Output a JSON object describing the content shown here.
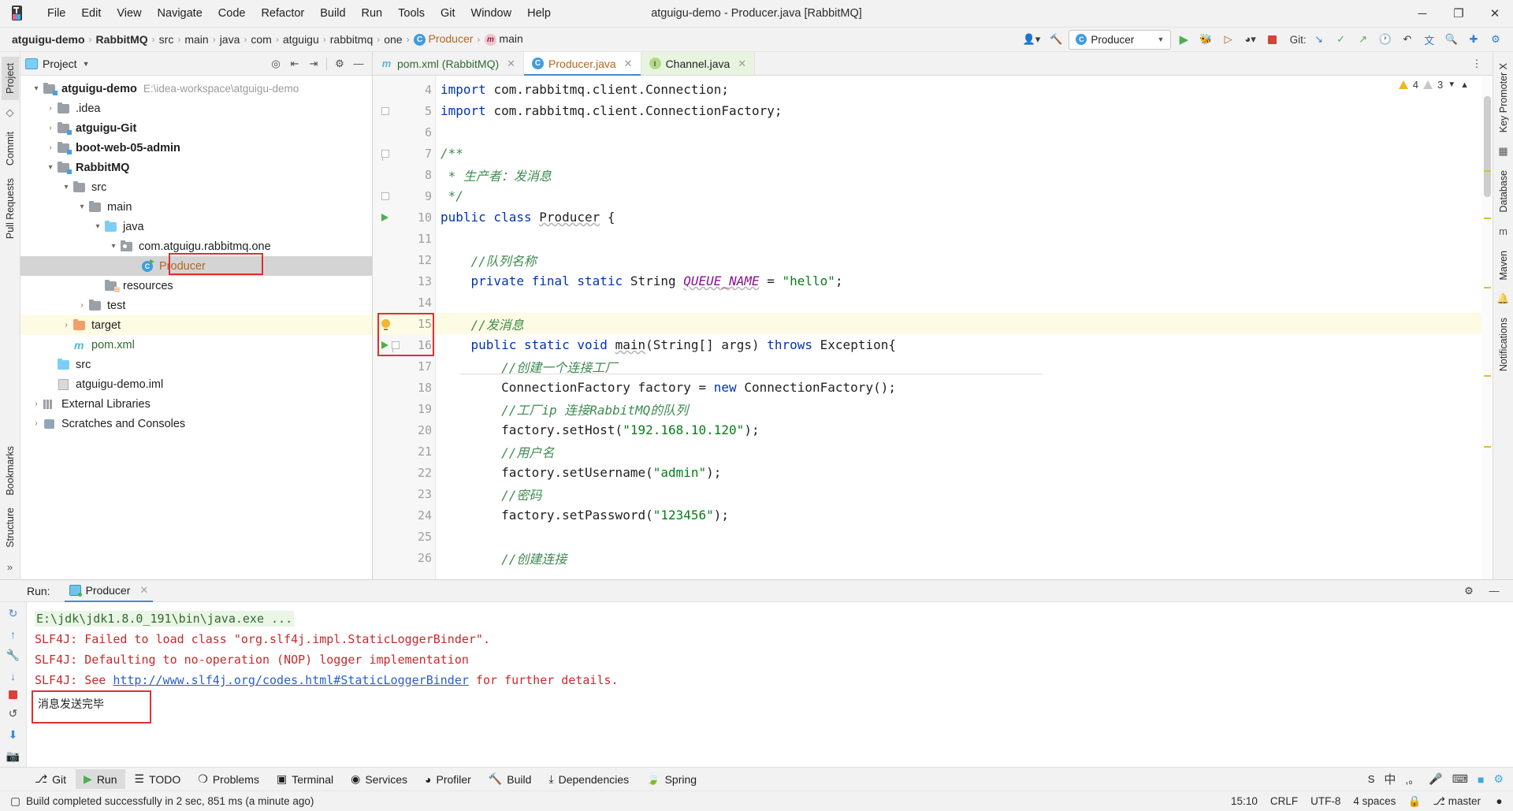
{
  "window": {
    "title": "atguigu-demo - Producer.java [RabbitMQ]",
    "minimize": "─",
    "maximize": "❐",
    "close": "✕"
  },
  "menubar": [
    {
      "label": "File"
    },
    {
      "label": "Edit"
    },
    {
      "label": "View"
    },
    {
      "label": "Navigate"
    },
    {
      "label": "Code"
    },
    {
      "label": "Refactor"
    },
    {
      "label": "Build"
    },
    {
      "label": "Run"
    },
    {
      "label": "Tools"
    },
    {
      "label": "Git"
    },
    {
      "label": "Window"
    },
    {
      "label": "Help"
    }
  ],
  "breadcrumb": [
    {
      "label": "atguigu-demo",
      "style": "bold"
    },
    {
      "label": "RabbitMQ",
      "style": "bold"
    },
    {
      "label": "src",
      "style": "normal"
    },
    {
      "label": "main",
      "style": "normal"
    },
    {
      "label": "java",
      "style": "normal"
    },
    {
      "label": "com",
      "style": "normal"
    },
    {
      "label": "atguigu",
      "style": "normal"
    },
    {
      "label": "rabbitmq",
      "style": "normal"
    },
    {
      "label": "one",
      "style": "normal"
    },
    {
      "label": "Producer",
      "style": "class"
    },
    {
      "label": "main",
      "style": "method"
    }
  ],
  "toolbar": {
    "run_config": "Producer",
    "git_label": "Git:",
    "separator": "›"
  },
  "project_panel": {
    "title": "Project",
    "tree": [
      {
        "indent": 0,
        "arrow": "v",
        "icon": "folder-module",
        "label": "atguigu-demo",
        "bold": true,
        "path": "E:\\idea-workspace\\atguigu-demo"
      },
      {
        "indent": 1,
        "arrow": ">",
        "icon": "folder-gray",
        "label": ".idea",
        "bold": false
      },
      {
        "indent": 1,
        "arrow": ">",
        "icon": "folder-module",
        "label": "atguigu-Git",
        "bold": true
      },
      {
        "indent": 1,
        "arrow": ">",
        "icon": "folder-module",
        "label": "boot-web-05-admin",
        "bold": true
      },
      {
        "indent": 1,
        "arrow": "v",
        "icon": "folder-module",
        "label": "RabbitMQ",
        "bold": true
      },
      {
        "indent": 2,
        "arrow": "v",
        "icon": "folder-gray",
        "label": "src",
        "bold": false
      },
      {
        "indent": 3,
        "arrow": "v",
        "icon": "folder-gray",
        "label": "main",
        "bold": false
      },
      {
        "indent": 4,
        "arrow": "v",
        "icon": "folder-blue",
        "label": "java",
        "bold": false
      },
      {
        "indent": 5,
        "arrow": "v",
        "icon": "package",
        "label": "com.atguigu.rabbitmq.one",
        "bold": false
      },
      {
        "indent": 6,
        "arrow": "",
        "icon": "java-class",
        "label": "Producer",
        "bold": false,
        "color": "orange",
        "selected": true,
        "boxed": true
      },
      {
        "indent": 5,
        "arrow": "",
        "icon": "folder-res",
        "label": "resources",
        "bold": false
      },
      {
        "indent": 3,
        "arrow": ">",
        "icon": "folder-gray",
        "label": "test",
        "bold": false
      },
      {
        "indent": 2,
        "arrow": ">",
        "icon": "folder-orange",
        "label": "target",
        "bold": false,
        "highlight": true
      },
      {
        "indent": 2,
        "arrow": "",
        "icon": "maven",
        "label": "pom.xml",
        "bold": false,
        "color": "green"
      },
      {
        "indent": 1,
        "arrow": "",
        "icon": "folder-blue",
        "label": "src",
        "bold": false
      },
      {
        "indent": 1,
        "arrow": "",
        "icon": "iml",
        "label": "atguigu-demo.iml",
        "bold": false
      },
      {
        "indent": 0,
        "arrow": ">",
        "icon": "library",
        "label": "External Libraries",
        "bold": false
      },
      {
        "indent": 0,
        "arrow": ">",
        "icon": "scratch",
        "label": "Scratches and Consoles",
        "bold": false
      }
    ]
  },
  "left_strip": [
    "Project",
    "Commit",
    "Pull Requests"
  ],
  "right_strip": [
    "Key Promoter X",
    "Database",
    "Maven",
    "Notifications"
  ],
  "editor": {
    "tabs": [
      {
        "label": "pom.xml (RabbitMQ)",
        "icon": "maven-icon",
        "active": false,
        "kind": "xml"
      },
      {
        "label": "Producer.java",
        "icon": "java-class-icon",
        "active": true,
        "kind": "java"
      },
      {
        "label": "Channel.java",
        "icon": "java-interface-icon",
        "active": false,
        "kind": "java"
      }
    ],
    "inspections": {
      "warnings": "4",
      "weak_warnings": "3"
    },
    "lines": [
      {
        "num": "4",
        "marks": [],
        "tokens": [
          {
            "t": "import ",
            "c": "kw"
          },
          {
            "t": "com.rabbitmq.client.Connection;",
            "c": "plain"
          }
        ]
      },
      {
        "num": "5",
        "marks": [
          "fold"
        ],
        "tokens": [
          {
            "t": "import ",
            "c": "kw"
          },
          {
            "t": "com.rabbitmq.client.ConnectionFactory;",
            "c": "plain"
          }
        ]
      },
      {
        "num": "6",
        "marks": [],
        "tokens": []
      },
      {
        "num": "7",
        "marks": [
          "fold-open"
        ],
        "tokens": [
          {
            "t": "/**",
            "c": "cmt"
          }
        ]
      },
      {
        "num": "8",
        "marks": [],
        "tokens": [
          {
            "t": " * 生产者：发消息",
            "c": "cmt"
          }
        ]
      },
      {
        "num": "9",
        "marks": [
          "fold-end"
        ],
        "tokens": [
          {
            "t": " */",
            "c": "cmt"
          }
        ]
      },
      {
        "num": "10",
        "marks": [
          "run"
        ],
        "tokens": [
          {
            "t": "public class ",
            "c": "kw"
          },
          {
            "t": "Producer",
            "c": "cls2"
          },
          {
            "t": " {",
            "c": "plain"
          }
        ]
      },
      {
        "num": "11",
        "marks": [],
        "tokens": []
      },
      {
        "num": "12",
        "marks": [],
        "tokens": [
          {
            "t": "    //队列名称",
            "c": "cmt"
          }
        ]
      },
      {
        "num": "13",
        "marks": [],
        "tokens": [
          {
            "t": "    ",
            "c": "plain"
          },
          {
            "t": "private final static ",
            "c": "kw"
          },
          {
            "t": "String ",
            "c": "plain"
          },
          {
            "t": "QUEUE_NAME",
            "c": "field"
          },
          {
            "t": " = ",
            "c": "plain"
          },
          {
            "t": "\"hello\"",
            "c": "str"
          },
          {
            "t": ";",
            "c": "plain"
          }
        ]
      },
      {
        "num": "14",
        "marks": [],
        "tokens": []
      },
      {
        "num": "15",
        "marks": [
          "bulb"
        ],
        "highlight": true,
        "tokens": [
          {
            "t": "    //发消息",
            "c": "cmt"
          }
        ]
      },
      {
        "num": "16",
        "marks": [
          "run",
          "fold-open"
        ],
        "tokens": [
          {
            "t": "    ",
            "c": "plain"
          },
          {
            "t": "public static void ",
            "c": "kw"
          },
          {
            "t": "main",
            "c": "cls2"
          },
          {
            "t": "(String[] args) ",
            "c": "plain"
          },
          {
            "t": "throws ",
            "c": "kw"
          },
          {
            "t": "Exception{",
            "c": "plain"
          }
        ]
      },
      {
        "num": "17",
        "marks": [],
        "tokens": [
          {
            "t": "        //创建一个连接工厂",
            "c": "cmt"
          }
        ]
      },
      {
        "num": "18",
        "marks": [],
        "tokens": [
          {
            "t": "        ConnectionFactory factory = ",
            "c": "plain"
          },
          {
            "t": "new ",
            "c": "kw"
          },
          {
            "t": "ConnectionFactory();",
            "c": "plain"
          }
        ]
      },
      {
        "num": "19",
        "marks": [],
        "tokens": [
          {
            "t": "        //工厂ip 连接RabbitMQ的队列",
            "c": "cmt"
          }
        ]
      },
      {
        "num": "20",
        "marks": [],
        "tokens": [
          {
            "t": "        factory.setHost(",
            "c": "plain"
          },
          {
            "t": "\"192.168.10.120\"",
            "c": "str"
          },
          {
            "t": ");",
            "c": "plain"
          }
        ]
      },
      {
        "num": "21",
        "marks": [],
        "tokens": [
          {
            "t": "        //用户名",
            "c": "cmt"
          }
        ]
      },
      {
        "num": "22",
        "marks": [],
        "tokens": [
          {
            "t": "        factory.setUsername(",
            "c": "plain"
          },
          {
            "t": "\"admin\"",
            "c": "str"
          },
          {
            "t": ");",
            "c": "plain"
          }
        ]
      },
      {
        "num": "23",
        "marks": [],
        "tokens": [
          {
            "t": "        //密码",
            "c": "cmt"
          }
        ]
      },
      {
        "num": "24",
        "marks": [],
        "tokens": [
          {
            "t": "        factory.setPassword(",
            "c": "plain"
          },
          {
            "t": "\"123456\"",
            "c": "str"
          },
          {
            "t": ");",
            "c": "plain"
          }
        ]
      },
      {
        "num": "25",
        "marks": [],
        "tokens": []
      },
      {
        "num": "26",
        "marks": [],
        "tokens": [
          {
            "t": "        //创建连接",
            "c": "cmt"
          }
        ]
      }
    ]
  },
  "run_panel": {
    "label": "Run:",
    "tab_label": "Producer",
    "console": [
      {
        "segments": [
          {
            "text": "E:\\jdk\\jdk1.8.0_191\\bin\\java.exe ...",
            "style": "green-bg"
          }
        ]
      },
      {
        "segments": [
          {
            "text": "SLF4J: Failed to load class \"org.slf4j.impl.StaticLoggerBinder\".",
            "style": "red"
          }
        ]
      },
      {
        "segments": [
          {
            "text": "SLF4J: Defaulting to no-operation (NOP) logger implementation",
            "style": "red"
          }
        ]
      },
      {
        "segments": [
          {
            "text": "SLF4J: See ",
            "style": "red"
          },
          {
            "text": "http://www.slf4j.org/codes.html#StaticLoggerBinder",
            "style": "link"
          },
          {
            "text": " for further details.",
            "style": "red"
          }
        ]
      },
      {
        "segments": [
          {
            "text": "消息发送完毕",
            "style": "black"
          }
        ],
        "boxed": true
      }
    ]
  },
  "bottom_tabs": [
    {
      "label": "Git",
      "icon": "git-branch-icon",
      "active": false
    },
    {
      "label": "Run",
      "icon": "run-icon",
      "active": true
    },
    {
      "label": "TODO",
      "icon": "todo-icon",
      "active": false
    },
    {
      "label": "Problems",
      "icon": "problems-icon",
      "active": false
    },
    {
      "label": "Terminal",
      "icon": "terminal-icon",
      "active": false
    },
    {
      "label": "Services",
      "icon": "services-icon",
      "active": false
    },
    {
      "label": "Profiler",
      "icon": "profiler-icon",
      "active": false
    },
    {
      "label": "Build",
      "icon": "build-icon",
      "active": false
    },
    {
      "label": "Dependencies",
      "icon": "dependencies-icon",
      "active": false
    },
    {
      "label": "Spring",
      "icon": "spring-icon",
      "active": false
    }
  ],
  "statusbar": {
    "message": "Build completed successfully in 2 sec, 851 ms (a minute ago)",
    "time": "15:10",
    "line_separator": "CRLF",
    "encoding": "UTF-8",
    "indent": "4 spaces",
    "branch": "master",
    "tray": {
      "ime": "中",
      "sogou": "S"
    }
  },
  "colors": {
    "accent": "#3f8cd6",
    "highlight": "#fdfbe3",
    "selection": "#d4d4d4",
    "red_box": "#e03030",
    "error_text": "#c7292a",
    "link": "#2a60c8"
  }
}
